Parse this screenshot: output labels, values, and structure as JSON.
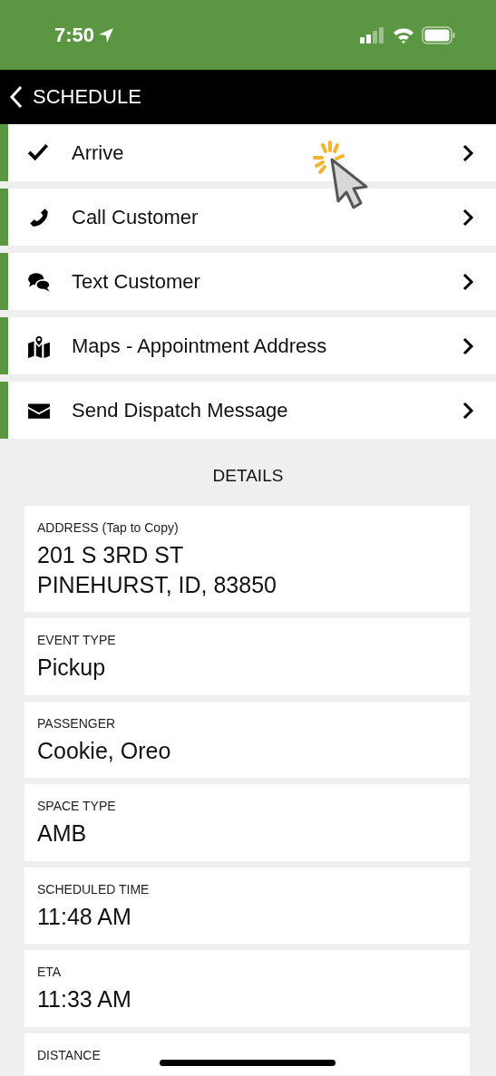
{
  "status_bar": {
    "time": "7:50"
  },
  "nav": {
    "back_label": "SCHEDULE"
  },
  "actions": [
    {
      "label": "Arrive",
      "kind": "check"
    },
    {
      "label": "Call Customer",
      "kind": "phone"
    },
    {
      "label": "Text Customer",
      "kind": "chat"
    },
    {
      "label": "Maps - Appointment Address",
      "kind": "map"
    },
    {
      "label": "Send Dispatch Message",
      "kind": "mail"
    }
  ],
  "details": {
    "heading": "DETAILS",
    "fields": [
      {
        "label": "ADDRESS (Tap to Copy)",
        "value": "201 S 3RD ST\nPINEHURST, ID, 83850"
      },
      {
        "label": "EVENT TYPE",
        "value": "Pickup"
      },
      {
        "label": "PASSENGER",
        "value": "Cookie, Oreo"
      },
      {
        "label": "SPACE TYPE",
        "value": "AMB"
      },
      {
        "label": "SCHEDULED TIME",
        "value": "11:48 AM"
      },
      {
        "label": "ETA",
        "value": "11:33 AM"
      },
      {
        "label": "DISTANCE"
      }
    ]
  }
}
